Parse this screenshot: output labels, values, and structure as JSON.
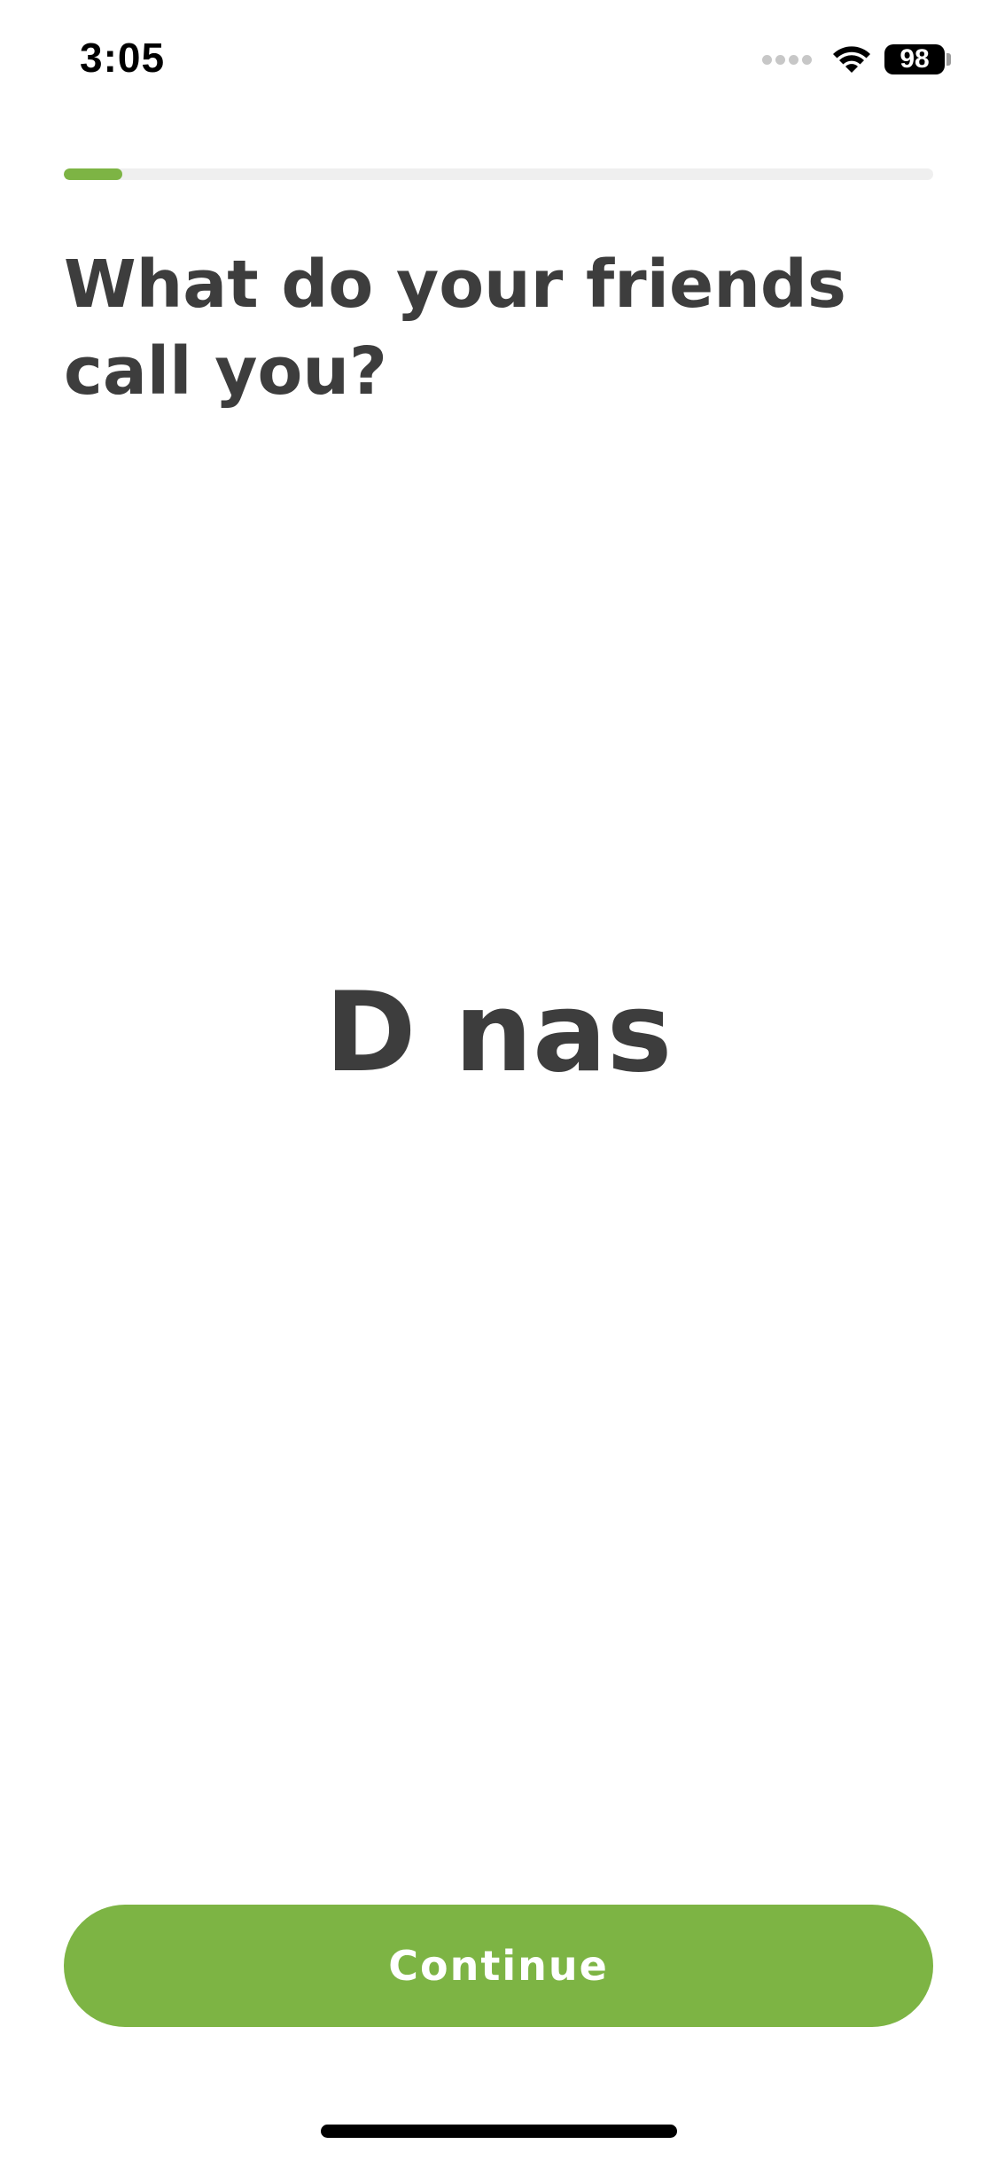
{
  "status_bar": {
    "time": "3:05",
    "battery_level": "98",
    "signal_icon": "cellular-signal-icon",
    "wifi_icon": "wifi-icon"
  },
  "progress": {
    "value_fraction": 0.067,
    "fill_color": "#7db444",
    "track_color": "#efefef"
  },
  "question": {
    "title": "What do your friends call you?"
  },
  "name_input": {
    "value": "D nas"
  },
  "footer": {
    "continue_label": "Continue",
    "button_color": "#7db444"
  }
}
